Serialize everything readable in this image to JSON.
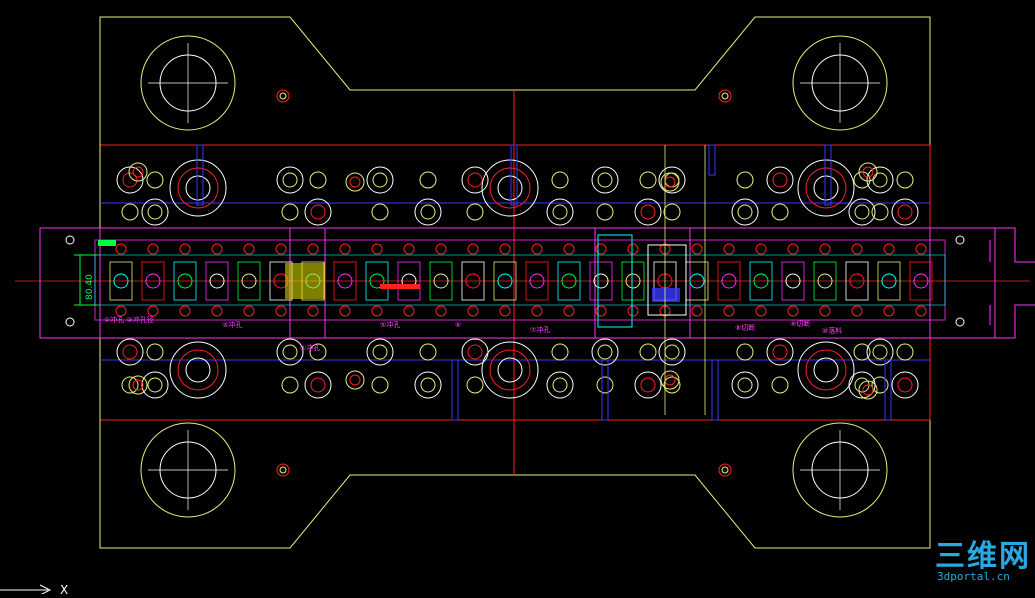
{
  "drawing": {
    "dimension_label": "80.40",
    "axis_label": "X",
    "notes": [
      "①冲孔 ②冲孔径",
      "③冲孔",
      "④冲孔",
      "⑤冲孔",
      "⑥",
      "⑦冲孔",
      "⑧切断",
      "⑨切断",
      "⑩落料"
    ]
  },
  "watermark": {
    "brand": "三维网",
    "url": "3dportal.cn"
  },
  "colors": {
    "background": "#000000",
    "yellow": "#e6f07a",
    "red": "#ff2020",
    "blue": "#3838ff",
    "magenta": "#ff30ff",
    "cyan": "#00ffff",
    "green": "#00ff40",
    "white": "#ffffff"
  }
}
